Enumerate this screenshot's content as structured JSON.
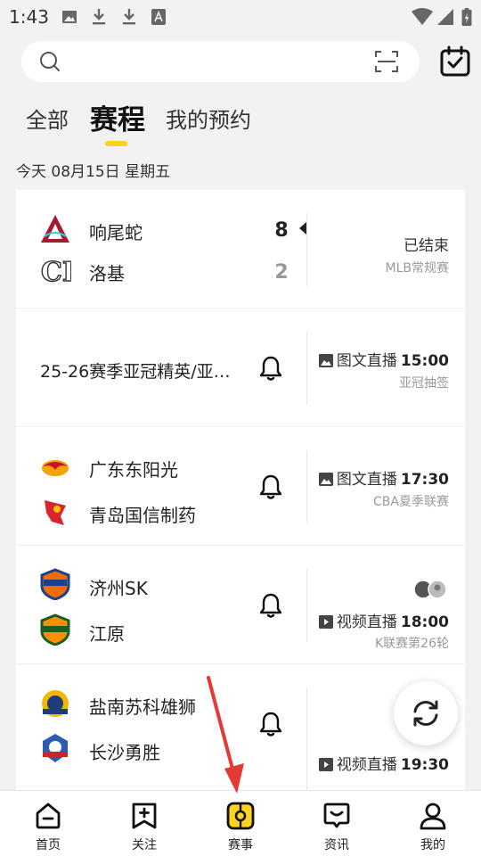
{
  "status_bar": {
    "time": "1:43"
  },
  "search": {
    "placeholder": ""
  },
  "tabs": [
    {
      "label": "全部",
      "active": false
    },
    {
      "label": "赛程",
      "active": true
    },
    {
      "label": "我的预约",
      "active": false
    }
  ],
  "date_label": "今天 08月15日 星期五",
  "matches": [
    {
      "teams": [
        {
          "name": "响尾蛇",
          "score": "8",
          "logo": "diamondbacks-logo"
        },
        {
          "name": "洛基",
          "score": "2",
          "logo": "rockies-logo"
        }
      ],
      "status": "已结束",
      "league": "MLB常规赛"
    },
    {
      "title": "25-26赛季亚冠精英/亚…",
      "broadcast": "图文直播",
      "time": "15:00",
      "league": "亚冠抽签"
    },
    {
      "teams": [
        {
          "name": "广东东阳光",
          "logo": "guangdong-logo"
        },
        {
          "name": "青岛国信制药",
          "logo": "qingdao-logo"
        }
      ],
      "broadcast": "图文直播",
      "time": "17:30",
      "league": "CBA夏季联赛"
    },
    {
      "teams": [
        {
          "name": "济州SK",
          "logo": "jeju-sk-logo"
        },
        {
          "name": "江原",
          "logo": "gangwon-logo"
        }
      ],
      "broadcast": "视频直播",
      "time": "18:00",
      "league": "K联赛第26轮"
    },
    {
      "teams": [
        {
          "name": "盐南苏科雄狮",
          "logo": "yannan-lions-logo"
        },
        {
          "name": "长沙勇胜",
          "logo": "changsha-logo"
        }
      ],
      "broadcast": "视频直播",
      "time": "19:30"
    }
  ],
  "bottom_nav": [
    {
      "label": "首页",
      "icon": "home-icon"
    },
    {
      "label": "关注",
      "icon": "follow-icon"
    },
    {
      "label": "赛事",
      "icon": "match-icon",
      "active": true
    },
    {
      "label": "资讯",
      "icon": "news-icon"
    },
    {
      "label": "我的",
      "icon": "profile-icon"
    }
  ],
  "colors": {
    "accent": "#ffd21f",
    "arrow": "#e53935",
    "muted": "#9a9a9a"
  }
}
